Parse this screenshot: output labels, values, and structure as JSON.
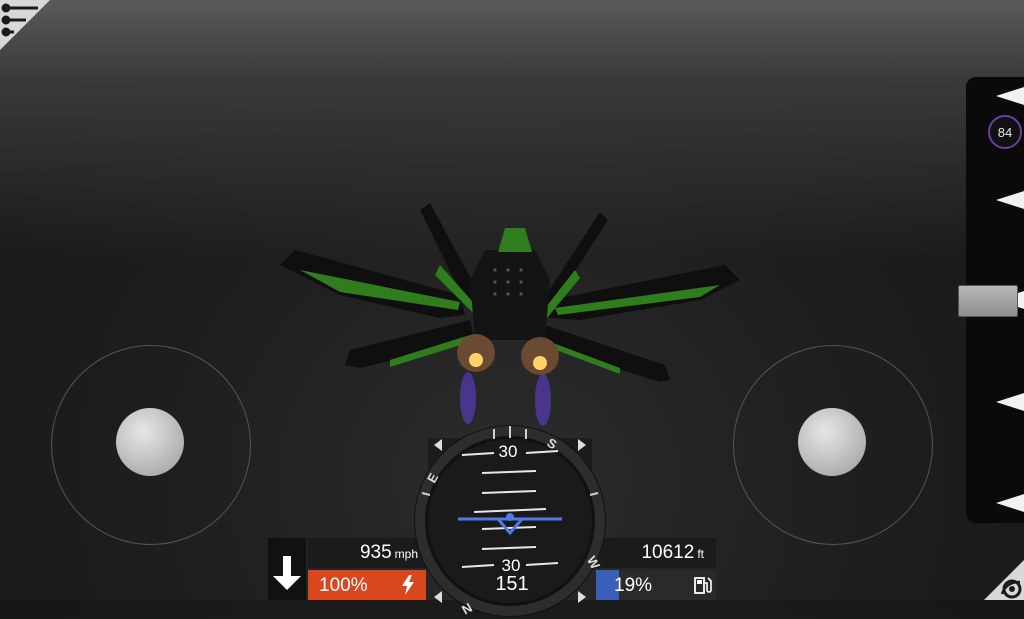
{
  "hud": {
    "speed_value": "935",
    "speed_unit": "mph",
    "altitude_value": "10612",
    "altitude_unit": "ft",
    "throttle_percent": "100%",
    "throttle_level": 1.0,
    "fuel_percent": "19%",
    "fuel_level": 0.19,
    "heading": "151"
  },
  "attitude": {
    "pitch_label_top": "30",
    "pitch_label_bottom": "30",
    "compass_letters": [
      "S",
      "E",
      "W",
      "N"
    ]
  },
  "timer": {
    "value": "84"
  },
  "colors": {
    "throttle_bar": "#d9471f",
    "fuel_bar": "#3a5fb8",
    "horizon_marker": "#4d7be8",
    "timer_ring": "#6a3fa0",
    "jet_accent": "#2f7d1c"
  },
  "icons": [
    "menu-icon",
    "down-arrow-icon",
    "lightning-icon",
    "fuel-pump-icon",
    "camera-icon"
  ]
}
